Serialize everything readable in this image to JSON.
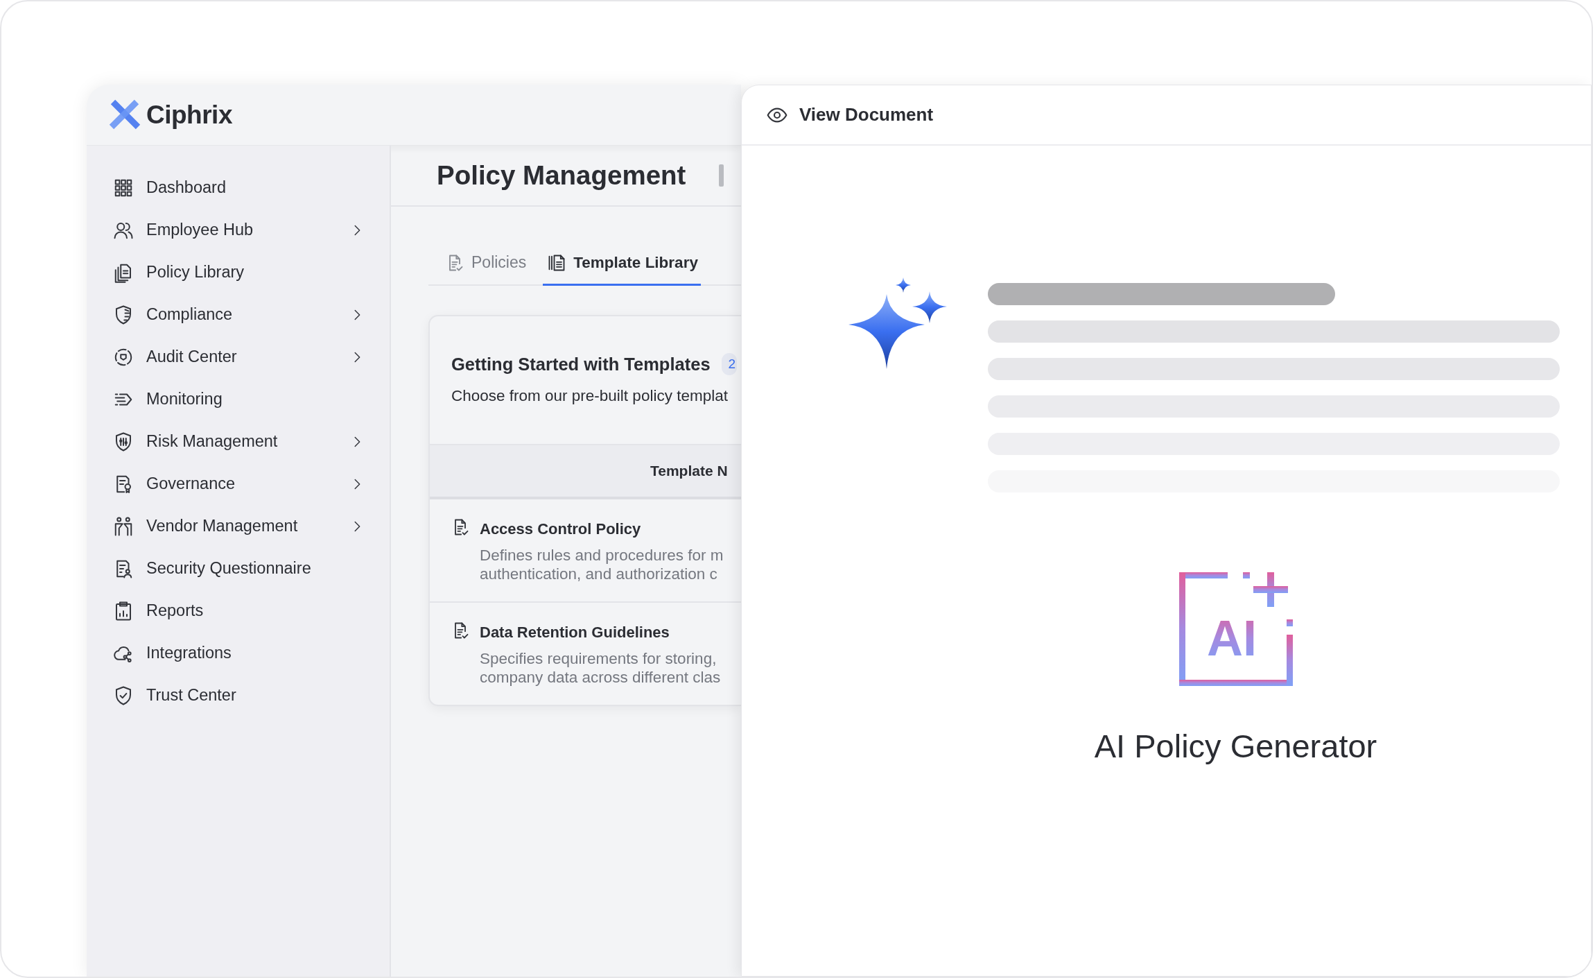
{
  "brand": {
    "name": "Ciphrix"
  },
  "sidebar": {
    "items": [
      {
        "label": "Dashboard",
        "expandable": false
      },
      {
        "label": "Employee Hub",
        "expandable": true
      },
      {
        "label": "Policy Library",
        "expandable": false
      },
      {
        "label": "Compliance",
        "expandable": true
      },
      {
        "label": "Audit Center",
        "expandable": true
      },
      {
        "label": "Monitoring",
        "expandable": false
      },
      {
        "label": "Risk Management",
        "expandable": true
      },
      {
        "label": "Governance",
        "expandable": true
      },
      {
        "label": "Vendor Management",
        "expandable": true
      },
      {
        "label": "Security Questionnaire",
        "expandable": false
      },
      {
        "label": "Reports",
        "expandable": false
      },
      {
        "label": "Integrations",
        "expandable": false
      },
      {
        "label": "Trust Center",
        "expandable": false
      }
    ]
  },
  "page": {
    "title": "Policy Management",
    "tabs": [
      {
        "label": "Policies",
        "selected": false
      },
      {
        "label": "Template Library",
        "selected": true
      }
    ],
    "card": {
      "title": "Getting Started with Templates",
      "badge": "2",
      "subtitle": "Choose from our pre-built policy templat",
      "table": {
        "columns": [
          "Template N"
        ],
        "rows": [
          {
            "name": "Access Control Policy",
            "description_lines": [
              "Defines rules and procedures for m",
              "authentication, and authorization c"
            ]
          },
          {
            "name": "Data Retention Guidelines",
            "description_lines": [
              "Specifies requirements for storing,",
              "company data across different clas"
            ]
          }
        ]
      }
    }
  },
  "panel": {
    "title": "View Document",
    "generator": {
      "icon_text": "AI",
      "title": "AI Policy Generator"
    }
  }
}
